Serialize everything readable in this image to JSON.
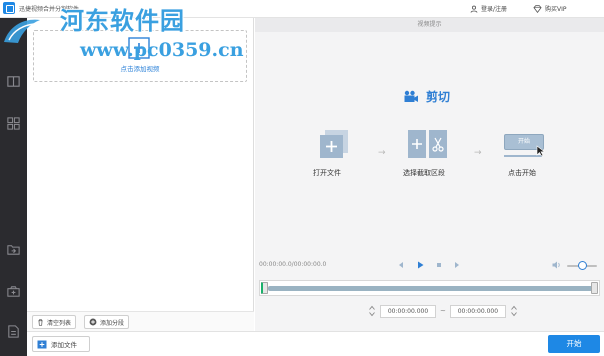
{
  "window": {
    "title": "迅捷视频合并分割软件",
    "login_label": "登录/注册",
    "vip_label": "购买VIP"
  },
  "watermark": {
    "site_name": "河东软件园",
    "url": "www.pc0359.cn"
  },
  "sidebar": {
    "items": [
      {
        "icon": "split-screen-icon"
      },
      {
        "icon": "grid-icon"
      },
      {
        "icon": "import-icon"
      },
      {
        "icon": "camera-add-icon"
      },
      {
        "icon": "document-icon"
      }
    ]
  },
  "file_panel": {
    "drop_hint": "点击添加视频",
    "clear_list_label": "清空列表",
    "add_segment_label": "添加分段"
  },
  "preview": {
    "header": "视频提示",
    "heading": "剪切",
    "steps": [
      {
        "label": "打开文件",
        "icon": "open-file-icon"
      },
      {
        "label": "选择截取区段",
        "icon": "scissors-icon"
      },
      {
        "label": "点击开始",
        "icon": "start-click-icon",
        "button_text": "开始"
      }
    ],
    "time_display": "00:00:00.0/00:00:00.0",
    "range_start": "00:00:00.000",
    "range_separator": "~",
    "range_end": "00:00:00.000",
    "volume_level": 0.5
  },
  "bottom": {
    "add_file_label": "添加文件",
    "start_label": "开始"
  },
  "colors": {
    "accent": "#1e88e5",
    "sidebar_bg": "#2b2b2f",
    "heading_blue": "#2f7fd4",
    "timeline_green": "#1bb06b"
  }
}
